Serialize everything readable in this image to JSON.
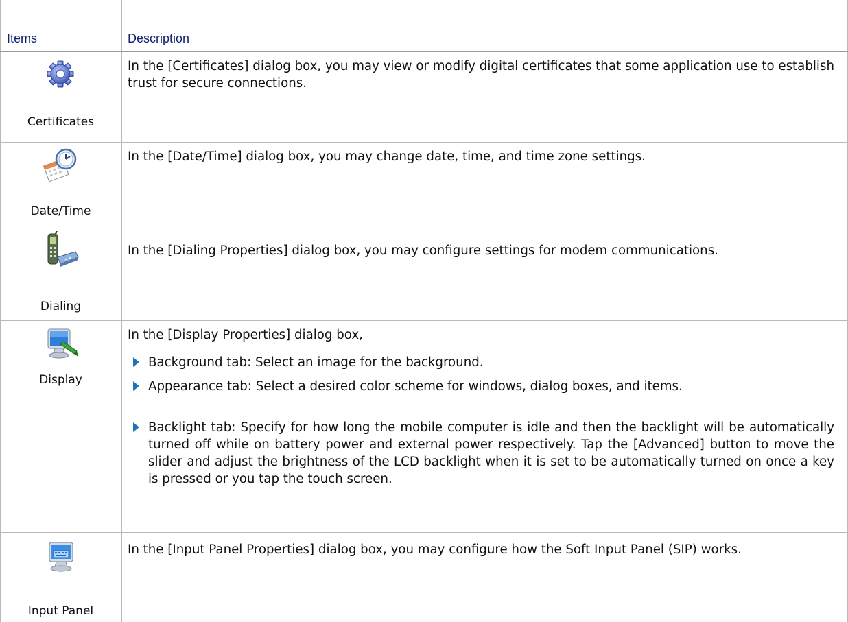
{
  "table": {
    "headers": {
      "items": "Items",
      "description": "Description"
    },
    "rows": [
      {
        "icon": "gear-icon",
        "label": "Certificates",
        "text": "In the [Certificates] dialog box, you may view or modify digital certificates that some application use to establish trust for secure connections."
      },
      {
        "icon": "calendar-clock-icon",
        "label": "Date/Time",
        "text": "In the [Date/Time] dialog box, you may change date, time, and time zone settings."
      },
      {
        "icon": "phone-modem-icon",
        "label": "Dialing",
        "text": "In the [Dialing Properties] dialog box, you may configure settings for modem communications."
      },
      {
        "icon": "monitor-pen-icon",
        "label": "Display",
        "text": "In the [Display Properties] dialog box,",
        "bullets": [
          "Background tab: Select an image for the background.",
          "Appearance tab: Select a desired color scheme for windows, dialog boxes, and items.",
          "Backlight tab: Specify for how long the mobile computer is idle and then the backlight will be automatically turned off while on battery power and external power respectively. Tap the [Advanced] button to move the slider and adjust the brightness of the LCD backlight when it is set to be automatically turned on once a key is pressed or you tap the touch screen."
        ]
      },
      {
        "icon": "monitor-keyboard-icon",
        "label": "Input Panel",
        "text": "In the [Input Panel Properties] dialog box, you may configure how the Soft Input Panel (SIP) works."
      }
    ]
  }
}
